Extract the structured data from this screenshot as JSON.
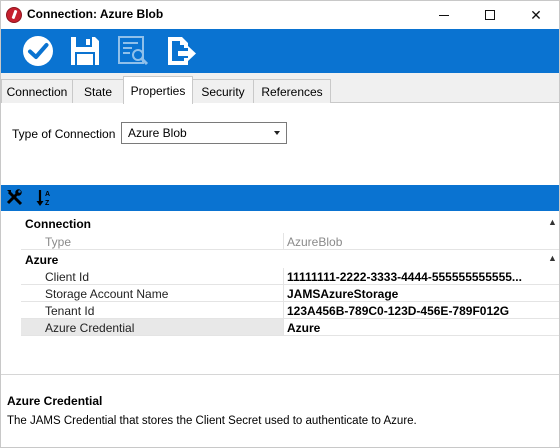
{
  "window": {
    "title": "Connection: Azure Blob",
    "minimize_glyph": "",
    "close_glyph": "✕"
  },
  "toolbar": {
    "buttons": [
      {
        "icon": "checkmark-circle-icon",
        "action": "ok"
      },
      {
        "icon": "floppy-disk-icon",
        "action": "save"
      },
      {
        "icon": "view-details-icon",
        "action": "view"
      },
      {
        "icon": "export-document-icon",
        "action": "export"
      }
    ],
    "accent_color": "#0a73d1"
  },
  "tabs": [
    {
      "label": "Connection",
      "active": false
    },
    {
      "label": "State",
      "active": false
    },
    {
      "label": "Properties",
      "active": true
    },
    {
      "label": "Security",
      "active": false
    },
    {
      "label": "References",
      "active": false
    }
  ],
  "type_of_connection": {
    "label": "Type of Connection",
    "value": "Azure Blob"
  },
  "property_grid": {
    "tools": [
      {
        "icon": "property-tools-icon"
      },
      {
        "icon": "sort-alphabetical-icon"
      }
    ],
    "categories": [
      {
        "name": "Connection",
        "toggle": "▲",
        "properties": [
          {
            "name": "Type",
            "value": "AzureBlob",
            "readonly": true
          }
        ]
      },
      {
        "name": "Azure",
        "toggle": "▲",
        "properties": [
          {
            "name": "Client Id",
            "value": "11111111-2222-3333-4444-555555555555...",
            "readonly": false
          },
          {
            "name": "Storage Account Name",
            "value": "JAMSAzureStorage",
            "readonly": false
          },
          {
            "name": "Tenant Id",
            "value": "123A456B-789C0-123D-456E-789F012G",
            "readonly": false
          },
          {
            "name": "Azure Credential",
            "value": "Azure",
            "readonly": false,
            "selected": true
          }
        ]
      }
    ]
  },
  "description": {
    "title": "Azure Credential",
    "text": "The JAMS Credential that stores the Client Secret used to authenticate to Azure."
  }
}
